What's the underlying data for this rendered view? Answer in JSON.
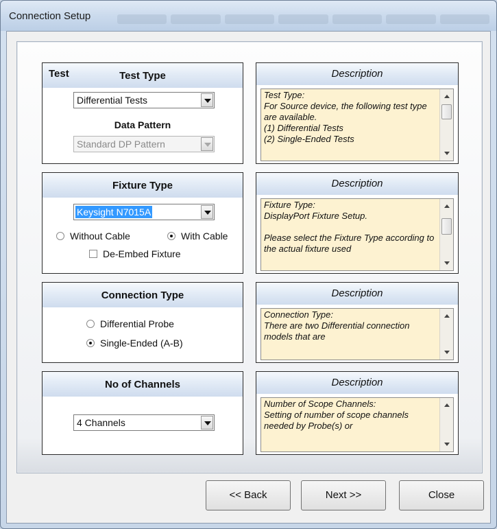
{
  "window": {
    "title": "Connection Setup"
  },
  "test_panel": {
    "corner_label": "Test",
    "title": "Test Type",
    "test_type_value": "Differential Tests",
    "data_pattern_label": "Data Pattern",
    "data_pattern_value": "Standard DP Pattern"
  },
  "test_desc": {
    "title": "Description",
    "text": "Test Type:\nFor Source device, the following test type are available.\n(1) Differential Tests\n(2) Single-Ended Tests"
  },
  "fixture_panel": {
    "title": "Fixture Type",
    "fixture_value": "Keysight N7015A",
    "without_cable_label": "Without Cable",
    "with_cable_label": "With Cable",
    "de_embed_label": "De-Embed Fixture"
  },
  "fixture_desc": {
    "title": "Description",
    "text": "Fixture Type:\nDisplayPort Fixture Setup.\n\nPlease select the Fixture Type according to the actual fixture used"
  },
  "connection_panel": {
    "title": "Connection Type",
    "differential_label": "Differential Probe",
    "single_ended_label": "Single-Ended (A-B)"
  },
  "connection_desc": {
    "title": "Description",
    "text": "Connection Type:\nThere are two Differential connection models that are"
  },
  "channels_panel": {
    "title": "No of Channels",
    "channels_value": "4 Channels"
  },
  "channels_desc": {
    "title": "Description",
    "text": "Number of Scope Channels:\nSetting of number of scope channels needed by Probe(s) or"
  },
  "footer": {
    "back_label": "<< Back",
    "next_label": "Next >>",
    "close_label": "Close"
  }
}
